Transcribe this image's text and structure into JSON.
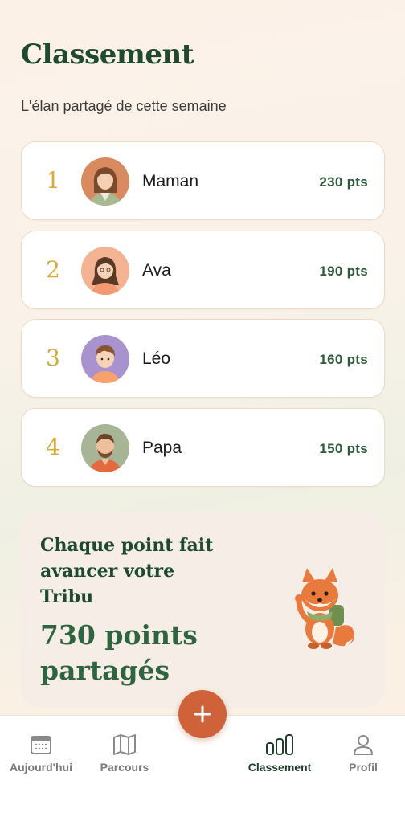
{
  "header": {
    "title": "Classement",
    "subtitle": "L'élan partagé de cette semaine"
  },
  "leaderboard": [
    {
      "rank": "1",
      "name": "Maman",
      "points": "230 pts",
      "avatar": "mother-avatar"
    },
    {
      "rank": "2",
      "name": "Ava",
      "points": "190 pts",
      "avatar": "girl-avatar"
    },
    {
      "rank": "3",
      "name": "Léo",
      "points": "160 pts",
      "avatar": "boy-avatar"
    },
    {
      "rank": "4",
      "name": "Papa",
      "points": "150 pts",
      "avatar": "father-avatar"
    }
  ],
  "summary": {
    "message": "Chaque point fait avancer votre Tribu",
    "total": "730 points partagés",
    "mascot": "fox-mascot"
  },
  "fab": {
    "icon": "plus-icon"
  },
  "nav": {
    "items": [
      {
        "label": "Aujourd'hui",
        "icon": "calendar-icon",
        "active": false
      },
      {
        "label": "Parcours",
        "icon": "map-icon",
        "active": false
      },
      {
        "label": "Classement",
        "icon": "bar-chart-icon",
        "active": true
      },
      {
        "label": "Profil",
        "icon": "user-icon",
        "active": false
      }
    ]
  },
  "colors": {
    "primary_green": "#1f4a30",
    "rank_gold": "#d9a93a",
    "accent_orange": "#cf6238"
  }
}
